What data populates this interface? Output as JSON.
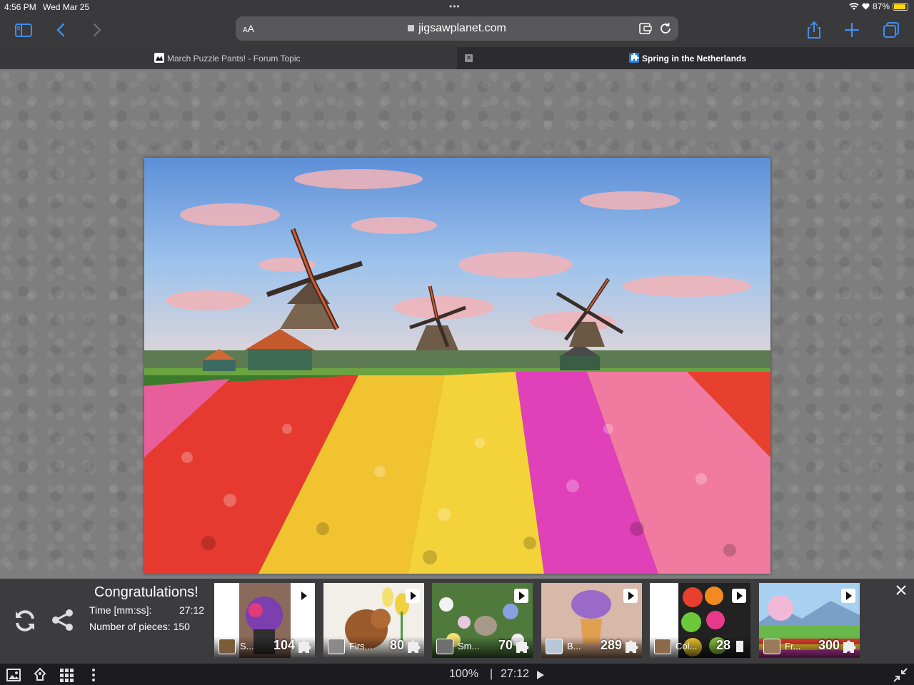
{
  "status_bar": {
    "time": "4:56 PM",
    "date": "Wed Mar 25",
    "battery": "87%",
    "battery_level": 0.87
  },
  "toolbar": {
    "reader_label_small": "A",
    "reader_label_large": "A",
    "url": "jigsawplanet.com"
  },
  "tabs": [
    {
      "label": "March Puzzle Pants! - Forum Topic",
      "active": false
    },
    {
      "label": "Spring in the Netherlands",
      "active": true
    }
  ],
  "panel": {
    "congrats": "Congratulations!",
    "time_label": "Time [mm:ss]:",
    "time_value": "27:12",
    "pieces_label": "Number of pieces: 150",
    "thumbs": [
      {
        "title": "S...",
        "count": "104"
      },
      {
        "title": "Firs...",
        "count": "80"
      },
      {
        "title": "Sm...",
        "count": "70"
      },
      {
        "title": "B...",
        "count": "289"
      },
      {
        "title": "Col...",
        "count": "28"
      },
      {
        "title": "Fr...",
        "count": "300"
      }
    ]
  },
  "footer": {
    "zoom": "100%",
    "separator": "|",
    "time": "27:12"
  },
  "colors": {
    "accent": "#3b8ff5",
    "battery": "#ffd60a"
  }
}
